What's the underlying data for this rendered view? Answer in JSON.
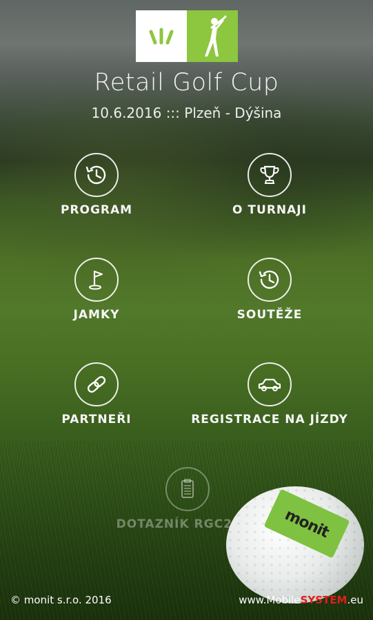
{
  "header": {
    "title": "Retail Golf Cup",
    "subtitle": "10.6.2016 ::: Plzeň - Dýšina"
  },
  "menu": {
    "program": {
      "label": "PROGRAM",
      "icon": "clock-icon"
    },
    "o_turnaji": {
      "label": "O TURNAJI",
      "icon": "trophy-icon"
    },
    "jamky": {
      "label": "JAMKY",
      "icon": "golf-flag-icon"
    },
    "souteze": {
      "label": "SOUTĚŽE",
      "icon": "clock-icon"
    },
    "partneri": {
      "label": "PARTNEŘI",
      "icon": "link-icon"
    },
    "registrace": {
      "label": "REGISTRACE NA JÍZDY",
      "icon": "car-icon"
    },
    "dotaznik": {
      "label": "DOTAZNÍK RGC2016",
      "icon": "clipboard-icon"
    }
  },
  "ball_logo_text": "monit",
  "footer": {
    "copyright": "© monit s.r.o. 2016",
    "site_prefix": "www.Mobile",
    "site_accent": "SYSTEM",
    "site_suffix": ".eu"
  },
  "colors": {
    "brand_green": "#8dc63f",
    "accent_red": "#e11d1d"
  }
}
